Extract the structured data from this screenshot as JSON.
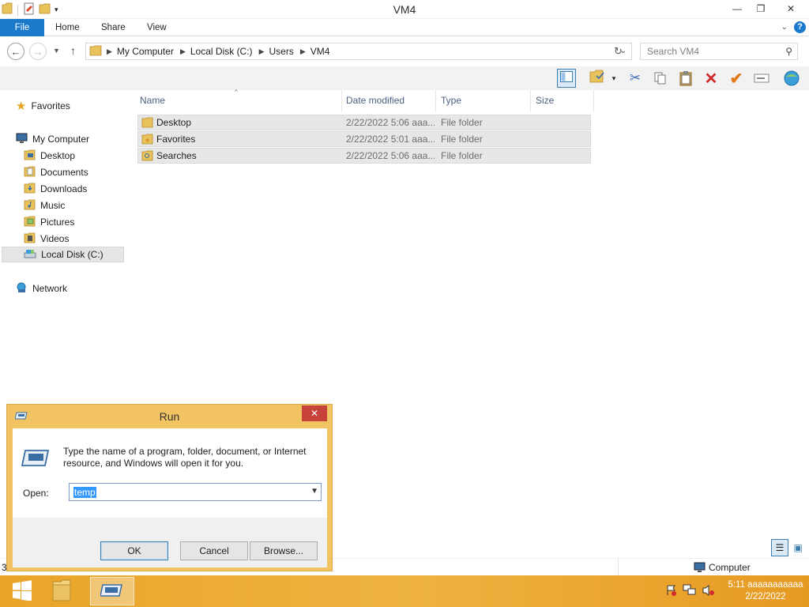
{
  "window": {
    "title": "VM4",
    "controls": {
      "minimize": "—",
      "maximize": "❐",
      "close": "✕"
    }
  },
  "ribbon": {
    "tabs": [
      "File",
      "Home",
      "Share",
      "View"
    ]
  },
  "address": {
    "breadcrumbs": [
      "My Computer",
      "Local Disk (C:)",
      "Users",
      "VM4"
    ],
    "search_placeholder": "Search VM4"
  },
  "nav": {
    "favorites": "Favorites",
    "my_computer": "My Computer",
    "items": [
      "Desktop",
      "Documents",
      "Downloads",
      "Music",
      "Pictures",
      "Videos",
      "Local Disk (C:)"
    ],
    "network": "Network"
  },
  "filelist": {
    "columns": [
      "Name",
      "Date modified",
      "Type",
      "Size"
    ],
    "rows": [
      {
        "name": "Desktop",
        "date": "2/22/2022 5:06 aaa...",
        "type": "File folder",
        "size": ""
      },
      {
        "name": "Favorites",
        "date": "2/22/2022 5:01 aaa...",
        "type": "File folder",
        "size": ""
      },
      {
        "name": "Searches",
        "date": "2/22/2022 5:06 aaa...",
        "type": "File folder",
        "size": ""
      }
    ]
  },
  "statusbar": {
    "item_count": "3",
    "location": "Computer"
  },
  "run_dialog": {
    "title": "Run",
    "description": "Type the name of a program, folder, document, or Internet resource, and Windows will open it for you.",
    "open_label": "Open:",
    "open_value": "temp",
    "buttons": {
      "ok": "OK",
      "cancel": "Cancel",
      "browse": "Browse..."
    }
  },
  "taskbar": {
    "time": "5:11 aaaaaaaaaaa",
    "date": "2/22/2022"
  },
  "colors": {
    "accent": "#1979ca",
    "taskbar": "#e9a429",
    "run_frame": "#f2c362",
    "close_red": "#c7423a"
  }
}
